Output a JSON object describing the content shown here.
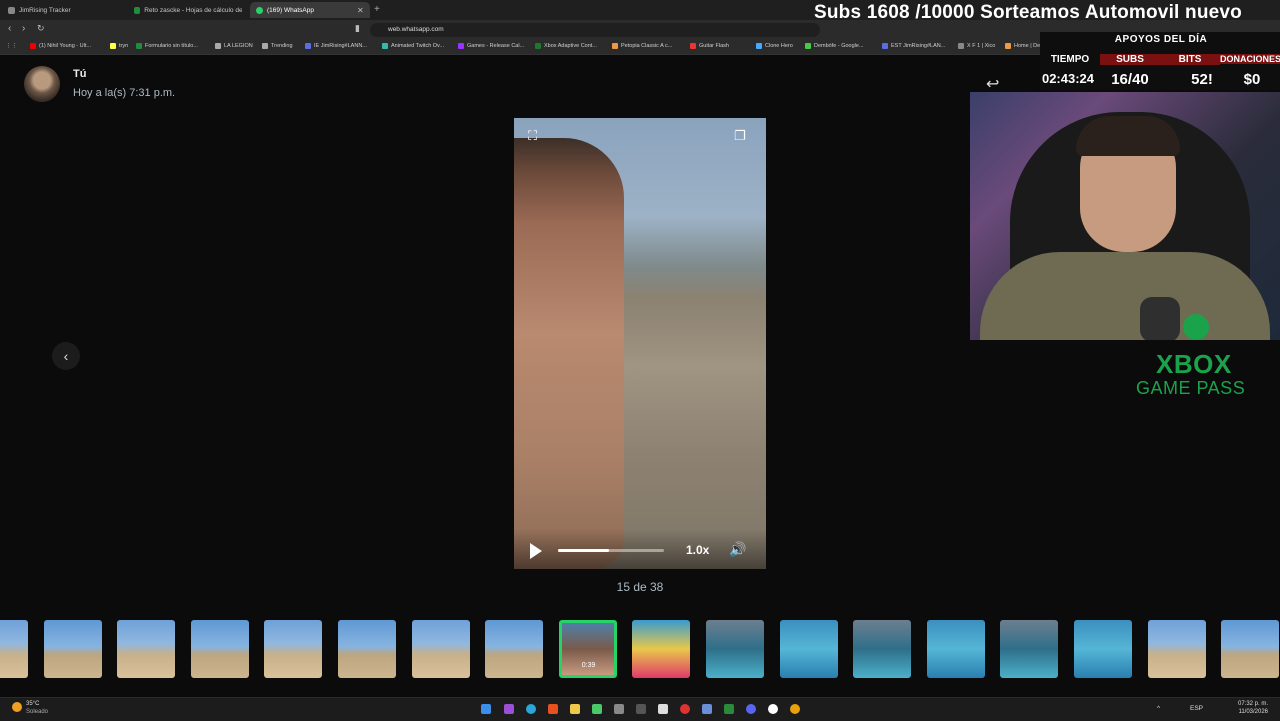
{
  "browser": {
    "tabs": [
      {
        "label": "JimRising Tracker",
        "color": "#888888"
      },
      {
        "label": "Reto zascke - Hojas de cálculo de Go",
        "color": "#1e8e3e"
      },
      {
        "label": "(169) WhatsApp",
        "color": "#25d366"
      }
    ],
    "url": "web.whatsapp.com",
    "bookmarks": [
      "(1) Nihil Young - Ult...",
      "tryn",
      "Formulario sin título...",
      "LA LEGION",
      "Trending",
      "IE JimRising#LANN...",
      "Animated Twitch Ov...",
      "Games - Release Cal...",
      "Xbox Adaptive Cont...",
      "Petopia Classic A c...",
      "Guitar Flash",
      "Clone Hero",
      "Dembófe - Google...",
      "EST JimRising#LAN...",
      "X F 1 | Xico",
      "Home | Dencoli..."
    ]
  },
  "viewer": {
    "sender": "Tú",
    "timestamp": "Hoy a la(s) 7:31 p.m.",
    "counter": "15 de 38",
    "speed": "1.0x",
    "progress": 0.48,
    "selected_thumb_duration": "0:39",
    "thumb_count": 18
  },
  "overlay": {
    "subs_banner": "Subs 1608 /10000 Sorteamos Automovil nuevo",
    "support_title": "APOYOS DEL DÍA",
    "stats": [
      {
        "label": "TIEMPO",
        "value": "02:43:24"
      },
      {
        "label": "SUBS",
        "value": "16/40"
      },
      {
        "label": "BITS",
        "value": "52!"
      },
      {
        "label": "DONACIONES",
        "value": "$0"
      }
    ],
    "gamepass_line1": "XBOX",
    "gamepass_line2": "GAME PASS"
  },
  "taskbar": {
    "weather_temp": "35°C",
    "weather_desc": "Soleado",
    "lang": "ESP",
    "time": "07:32 p. m.",
    "date": "11/03/2026"
  }
}
